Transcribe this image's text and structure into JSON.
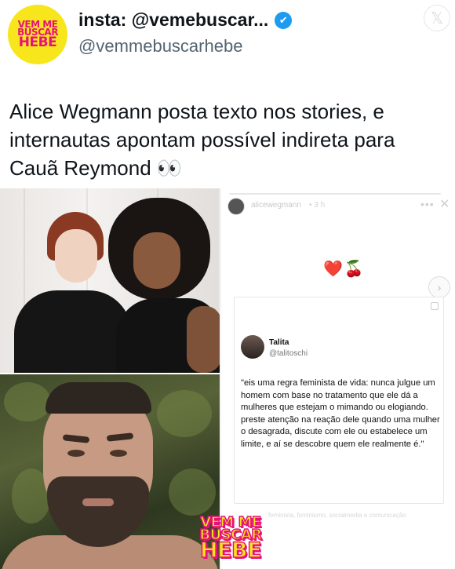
{
  "header": {
    "avatar_logo": {
      "line1": "VEM ME",
      "line2": "BUSCAR",
      "line3": "HEBE",
      "bg": "#f7e61c",
      "fg": "#e6127b"
    },
    "display_name": "insta: @vemebuscar...",
    "verified_icon": "✔",
    "handle": "@vemmebuscarhebe",
    "platform_icon": "x-logo-icon",
    "platform_glyph": "𝕏"
  },
  "tweet": {
    "text": "Alice Wegmann posta texto nos stories, e internautas apontam possível indireta para Cauã Reymond 👀"
  },
  "story": {
    "username": "alicewegmann",
    "time": "• 3 h",
    "more_glyph": "•••",
    "close_glyph": "✕",
    "emojis": "❤️🍒",
    "next_glyph": "›",
    "card": {
      "name": "Talita",
      "handle": "@talitoschi",
      "quote": "\"eis uma regra feminista de vida: nunca julgue um homem com base no tratamento que ele dá a mulheres que estejam o mimando ou elogiando. preste atenção na reação dele quando uma mulher o desagrada, discute com ele ou estabelece um limite, e aí se descobre quem ele realmente é.\""
    },
    "footer": "feminista, feminismo, socialmedia e comunicação"
  },
  "watermark": {
    "line1": "VEM ME",
    "line2": "BUSCAR",
    "line3": "HEBE"
  },
  "colors": {
    "verified": "#1d9bf0",
    "handle": "#536471",
    "text": "#0f1419"
  }
}
